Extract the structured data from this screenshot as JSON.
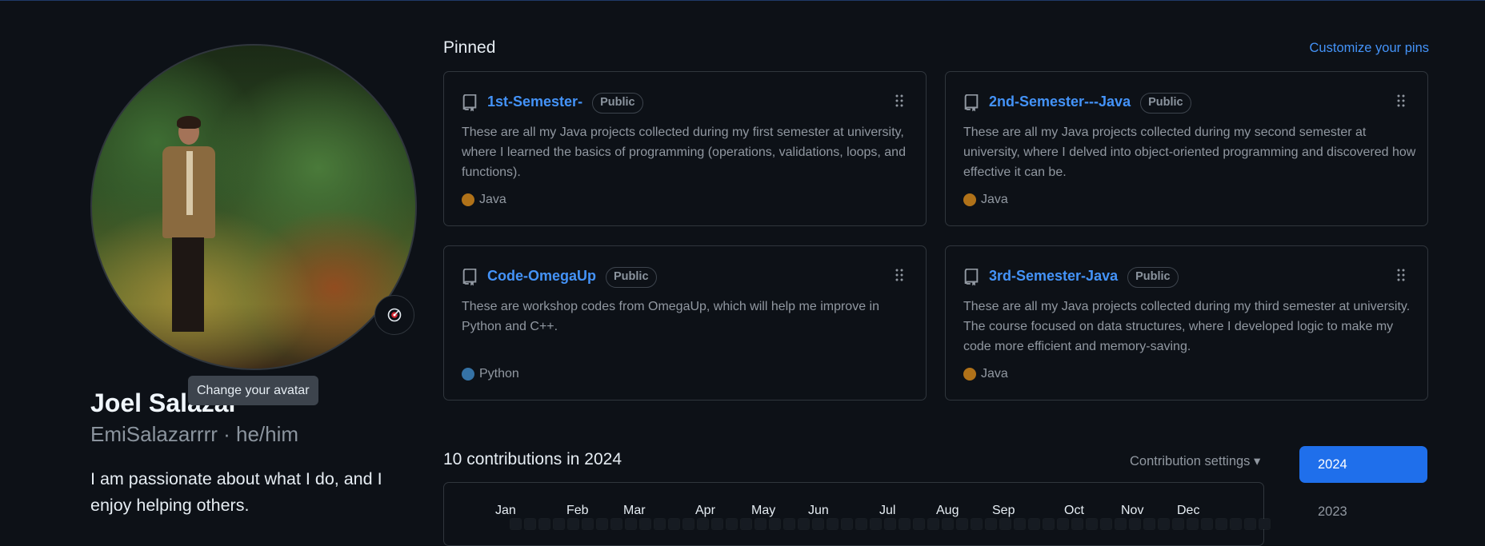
{
  "profile": {
    "name": "Joel Salazar",
    "login_line": "EmiSalazarrrr · he/him",
    "bio": "I am passionate about what I do, and I enjoy helping others.",
    "avatar_tooltip": "Change your avatar"
  },
  "pinned": {
    "heading": "Pinned",
    "customize_link": "Customize your pins",
    "repos": [
      {
        "name": "1st-Semester-",
        "visibility": "Public",
        "description": "These are all my Java projects collected during my first semester at university, where I learned the basics of programming (operations, validations, loops, and functions).",
        "language": "Java",
        "language_color": "#b07219"
      },
      {
        "name": "2nd-Semester---Java",
        "visibility": "Public",
        "description": "These are all my Java projects collected during my second semester at university, where I delved into object-oriented programming and discovered how effective it can be.",
        "language": "Java",
        "language_color": "#b07219"
      },
      {
        "name": "Code-OmegaUp",
        "visibility": "Public",
        "description": "These are workshop codes from OmegaUp, which will help me improve in Python and C++.",
        "language": "Python",
        "language_color": "#3572A5"
      },
      {
        "name": "3rd-Semester-Java",
        "visibility": "Public",
        "description": "These are all my Java projects collected during my third semester at university. The course focused on data structures, where I developed logic to make my code more efficient and memory-saving.",
        "language": "Java",
        "language_color": "#b07219"
      }
    ]
  },
  "contributions": {
    "heading": "10 contributions in 2024",
    "settings_label": "Contribution settings",
    "months": [
      "Jan",
      "Feb",
      "Mar",
      "Apr",
      "May",
      "Jun",
      "Jul",
      "Aug",
      "Sep",
      "Oct",
      "Nov",
      "Dec"
    ],
    "years": [
      "2024",
      "2023"
    ],
    "selected_year": "2024"
  },
  "colors": {
    "accent": "#4493f8",
    "year_button": "#1f6feb",
    "background": "#0d1117"
  }
}
